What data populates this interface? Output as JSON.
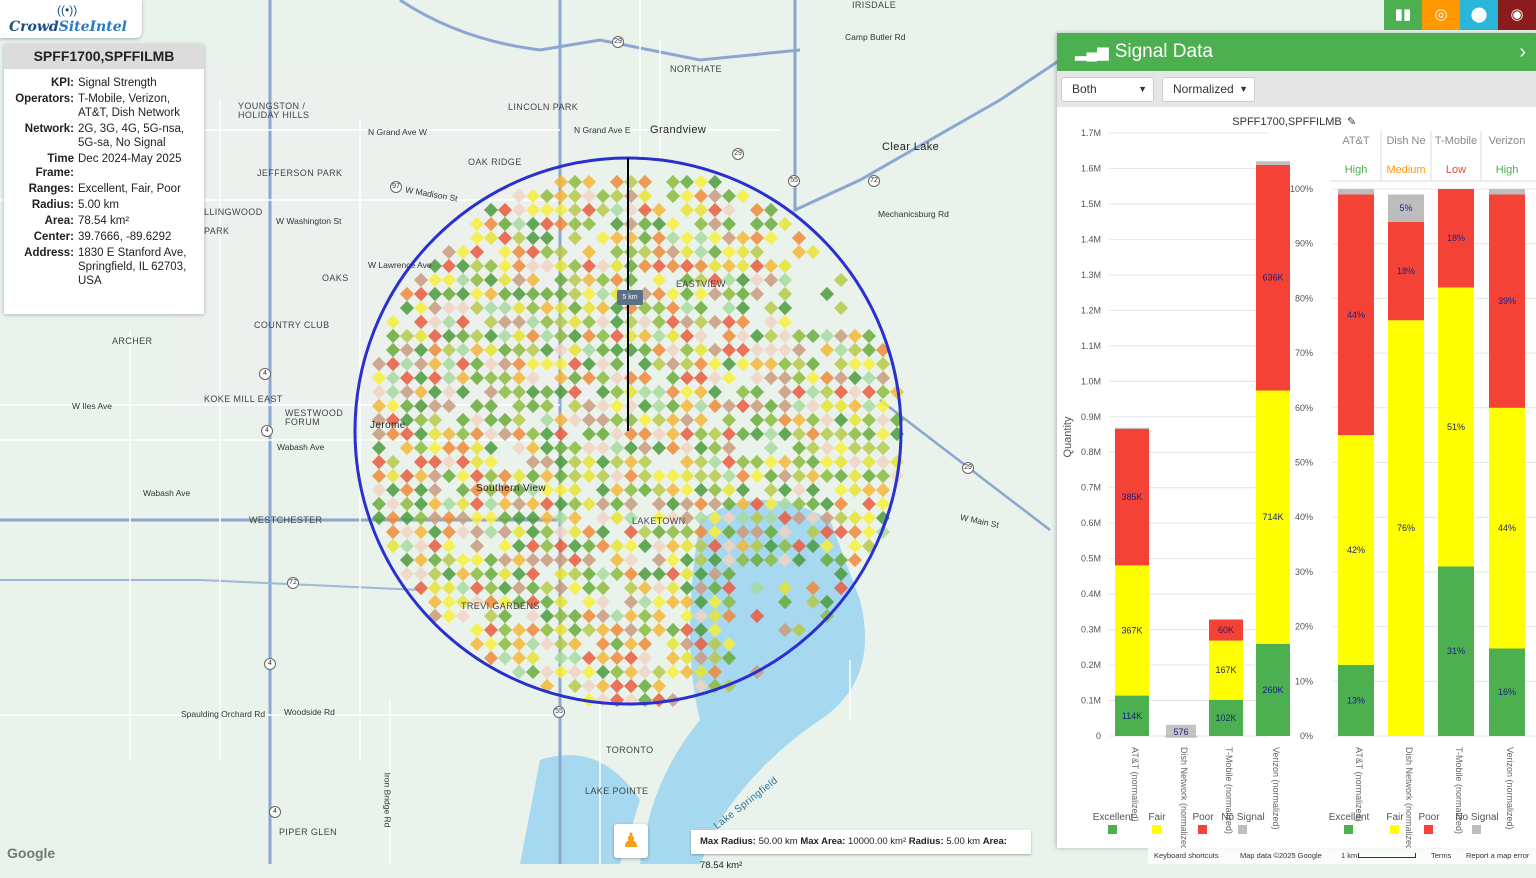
{
  "logo": {
    "text_a": "Crowd",
    "text_b": "SiteIntel",
    "wifi_icon": "wifi-icon"
  },
  "info": {
    "title": "SPFF1700,SPFFILMB",
    "rows": [
      {
        "k": "KPI:",
        "v": "Signal Strength"
      },
      {
        "k": "Operators:",
        "v": "T-Mobile, Verizon, AT&T, Dish Network"
      },
      {
        "k": "Network:",
        "v": "2G, 3G, 4G, 5G-nsa, 5G-sa, No Signal"
      },
      {
        "k": "Time Frame:",
        "v": "Dec 2024-May 2025"
      },
      {
        "k": "Ranges:",
        "v": "Excellent, Fair, Poor"
      },
      {
        "k": "Radius:",
        "v": "5.00 km"
      },
      {
        "k": "Area:",
        "v": "78.54 km²"
      },
      {
        "k": "Center:",
        "v": "39.7666, -89.6292"
      },
      {
        "k": "Address:",
        "v": "1830 E Stanford Ave, Springfield, IL 62703, USA"
      }
    ]
  },
  "map": {
    "circle_label": "5 km",
    "labels": [
      "IRISDALE",
      "NORTHATE",
      "LINCOLN PARK",
      "YOUNGSTON / HOLIDAY HILLS",
      "Grandview",
      "OAK RIDGE",
      "JEFFERSON PARK",
      "Clear Lake",
      "LLINGWOOD",
      "PARK",
      "OAKS",
      "COUNTRY CLUB",
      "ARCHER",
      "KOKE MILL EAST",
      "WESTWOOD FORUM",
      "WESTCHESTER",
      "EASTVIEW",
      "LAKETOWN",
      "TREVI GARDENS",
      "TORONTO",
      "LAKE POINTE",
      "PIPER GLEN",
      "Southern View",
      "Jerome",
      "Lake Springfield",
      "Camp Butler Rd",
      "Mechanicsburg Rd",
      "W Main St",
      "W Iles Ave",
      "Wabash Ave",
      "Spaulding Orchard Rd",
      "Woodside Rd",
      "N Grand Ave W",
      "N Grand Ave E",
      "W Madison St",
      "W Washington St",
      "W Lawrence Ave",
      "Wabash Ave",
      "Iron Bridge Rd"
    ],
    "shields": [
      "29",
      "97",
      "4",
      "55",
      "72",
      "29",
      "55",
      "4",
      "72",
      "4",
      "4",
      "29"
    ]
  },
  "buttons": [
    {
      "name": "chart-icon",
      "glyph": "▮▮",
      "color": "#4caf50"
    },
    {
      "name": "target-icon",
      "glyph": "◎",
      "color": "#ff9800"
    },
    {
      "name": "location-pin-icon",
      "glyph": "⬤",
      "color": "#29b6d8"
    },
    {
      "name": "globe-icon",
      "glyph": "◉",
      "color": "#8b1c1c"
    }
  ],
  "panel": {
    "title": "Signal Data",
    "select1": "Both",
    "select2": "Normalized",
    "chart_title": "SPFF1700,SPFFILMB"
  },
  "chart_data": [
    {
      "type": "bar",
      "stacked": true,
      "title": "SPFF1700,SPFFILMB",
      "ylabel": "Quantity",
      "ylim": [
        0,
        1700000
      ],
      "yticks": [
        "0",
        "0.1M",
        "0.2M",
        "0.3M",
        "0.4M",
        "0.5M",
        "0.6M",
        "0.7M",
        "0.8M",
        "0.9M",
        "1.0M",
        "1.1M",
        "1.2M",
        "1.3M",
        "1.4M",
        "1.5M",
        "1.6M",
        "1.7M"
      ],
      "categories": [
        "AT&T (normalized)",
        "Dish Network (normalized)",
        "T-Mobile (normalized)",
        "Verizon (normalized)"
      ],
      "series": [
        {
          "name": "Excellent",
          "color": "#4caf50",
          "values": [
            114000,
            0,
            102000,
            260000
          ],
          "labels": [
            "114K",
            "",
            "102K",
            "260K"
          ]
        },
        {
          "name": "Fair",
          "color": "#ffff00",
          "values": [
            367000,
            0,
            167000,
            714000
          ],
          "labels": [
            "367K",
            "",
            "167K",
            "714K"
          ]
        },
        {
          "name": "Poor",
          "color": "#f44336",
          "values": [
            385000,
            0,
            60000,
            636000
          ],
          "labels": [
            "385K",
            "",
            "60K",
            "636K"
          ]
        },
        {
          "name": "No Signal",
          "color": "#bdbdbd",
          "values": [
            3000,
            576,
            1000,
            10000
          ],
          "labels": [
            "",
            "576",
            "",
            ""
          ]
        }
      ]
    },
    {
      "type": "bar",
      "stacked": true,
      "ylim": [
        0,
        100
      ],
      "yticks": [
        "0%",
        "10%",
        "20%",
        "30%",
        "40%",
        "50%",
        "60%",
        "70%",
        "80%",
        "90%",
        "100%"
      ],
      "headers": [
        {
          "name": "AT&T",
          "quality": "High",
          "color": "#4caf50"
        },
        {
          "name": "Dish Ne",
          "quality": "Medium",
          "color": "#ff9800"
        },
        {
          "name": "T-Mobile",
          "quality": "Low",
          "color": "#f44336"
        },
        {
          "name": "Verizon",
          "quality": "High",
          "color": "#4caf50"
        }
      ],
      "categories": [
        "AT&T (normalized)",
        "Dish Network (normalized)",
        "T-Mobile (normalized)",
        "Verizon (normalized)"
      ],
      "series": [
        {
          "name": "Excellent",
          "color": "#4caf50",
          "values": [
            13,
            0,
            31,
            16
          ],
          "labels": [
            "13%",
            "",
            "31%",
            "16%"
          ]
        },
        {
          "name": "Fair",
          "color": "#ffff00",
          "values": [
            42,
            76,
            51,
            44
          ],
          "labels": [
            "42%",
            "76%",
            "51%",
            "44%"
          ]
        },
        {
          "name": "Poor",
          "color": "#f44336",
          "values": [
            44,
            18,
            18,
            39
          ],
          "labels": [
            "44%",
            "18%",
            "18%",
            "39%"
          ]
        },
        {
          "name": "No Signal",
          "color": "#bdbdbd",
          "values": [
            1,
            5,
            0,
            1
          ],
          "labels": [
            "",
            "5%",
            "",
            ""
          ]
        }
      ]
    }
  ],
  "legend": [
    "Excellent",
    "Fair",
    "Poor",
    "No Signal"
  ],
  "bottom": {
    "b1": "Max Radius:",
    "v1": "50.00 km",
    "b2": "Max Area:",
    "v2": "10000.00 km²",
    "b3": "Radius:",
    "v3": "5.00 km",
    "b4": "Area:",
    "v4": "78.54 km²"
  },
  "attribution": {
    "shortcuts": "Keyboard shortcuts",
    "mapdata": "Map data ©2025 Google",
    "scale": "1 km",
    "terms": "Terms",
    "report": "Report a map error"
  },
  "google": "Google"
}
